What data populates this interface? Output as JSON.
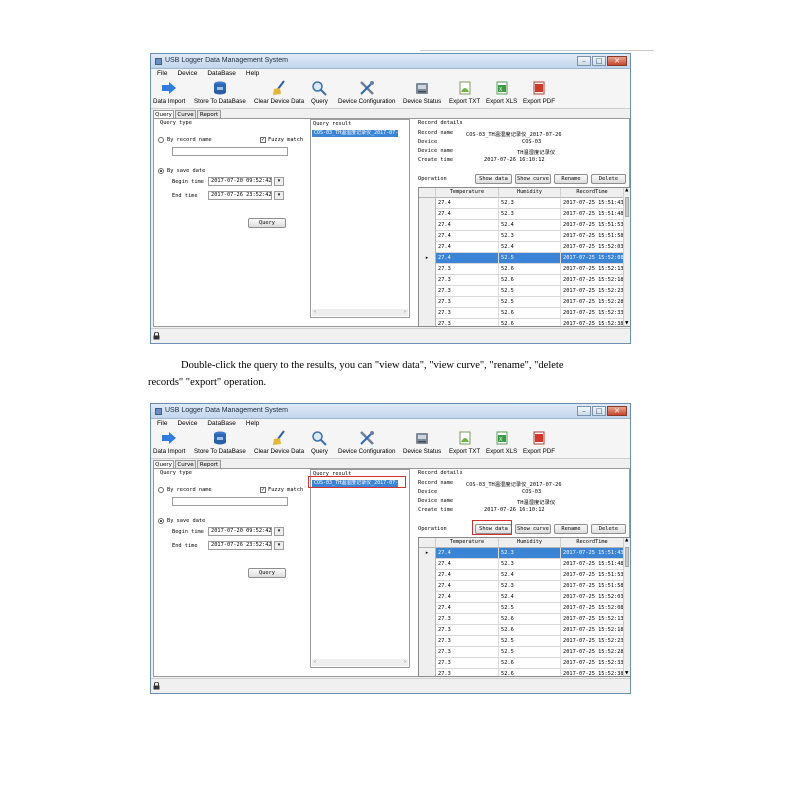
{
  "paragraph": {
    "line1": "Double-click the query to the results, you can \"view data\", \"view curve\", \"rename\", \"delete",
    "line2": "records\" \"export\" operation."
  },
  "app": {
    "title": "USB Logger Data Management System",
    "menus": [
      "File",
      "Device",
      "DataBase",
      "Help"
    ],
    "toolbar": [
      {
        "label": "Data Import",
        "icon": "arrow-right-icon"
      },
      {
        "label": "Store To DataBase",
        "icon": "database-icon"
      },
      {
        "label": "Clear Device Data",
        "icon": "broom-icon"
      },
      {
        "label": "Query",
        "icon": "magnifier-icon"
      },
      {
        "label": "Device Configuration",
        "icon": "tools-icon"
      },
      {
        "label": "Device Status",
        "icon": "device-icon"
      },
      {
        "label": "Export TXT",
        "icon": "txt-file-icon"
      },
      {
        "label": "Export XLS",
        "icon": "xls-file-icon"
      },
      {
        "label": "Export PDF",
        "icon": "pdf-file-icon"
      }
    ],
    "tabs": [
      "Query",
      "Curve",
      "Report"
    ],
    "query": {
      "query_type": "Query type",
      "by_record_name": "By record name",
      "fuzzy_match": "Fuzzy match",
      "by_save_date": "By save date",
      "begin_time_label": "Begin time",
      "begin_time_value": "2017-07-20 09:52:42",
      "end_time_label": "End time",
      "end_time_value": "2017-07-26 23:52:42",
      "query_button": "Query"
    },
    "query_result": {
      "header": "Query result",
      "item": "COS-03_TH温湿度记录仪_2017-07-26"
    },
    "record_details": {
      "header": "Record details",
      "record_name_label": "Record name",
      "record_name_value": "COS-03_TH温湿度记录仪_2017-07-26",
      "device_label": "Device",
      "device_value": "COS-03",
      "device_name_label": "Device name",
      "device_name_value": "TH温湿度记录仪",
      "create_time_label": "Create time",
      "create_time_value": "2017-07-26 16:10:12",
      "operation_label": "Operation",
      "buttons": [
        "Show data",
        "Show curve",
        "Rename",
        "Delete"
      ]
    },
    "table": {
      "columns": [
        "Temperature",
        "Humidity",
        "RecordTime"
      ],
      "rows_window1": [
        [
          "27.4",
          "52.3",
          "2017-07-25 15:51:43"
        ],
        [
          "27.4",
          "52.3",
          "2017-07-25 15:51:48"
        ],
        [
          "27.4",
          "52.4",
          "2017-07-25 15:51:53"
        ],
        [
          "27.4",
          "52.3",
          "2017-07-25 15:51:58"
        ],
        [
          "27.4",
          "52.4",
          "2017-07-25 15:52:03"
        ],
        [
          "27.4",
          "52.5",
          "2017-07-25 15:52:08"
        ],
        [
          "27.3",
          "52.6",
          "2017-07-25 15:52:13"
        ],
        [
          "27.3",
          "52.6",
          "2017-07-25 15:52:18"
        ],
        [
          "27.3",
          "52.5",
          "2017-07-25 15:52:23"
        ],
        [
          "27.3",
          "52.5",
          "2017-07-25 15:52:28"
        ],
        [
          "27.3",
          "52.6",
          "2017-07-25 15:52:33"
        ],
        [
          "27.3",
          "52.6",
          "2017-07-25 15:52:38"
        ]
      ],
      "selected_row_window1": 5,
      "rows_window2": [
        [
          "27.4",
          "52.3",
          "2017-07-25 15:51:43"
        ],
        [
          "27.4",
          "52.3",
          "2017-07-25 15:51:48"
        ],
        [
          "27.4",
          "52.4",
          "2017-07-25 15:51:53"
        ],
        [
          "27.4",
          "52.3",
          "2017-07-25 15:51:58"
        ],
        [
          "27.4",
          "52.4",
          "2017-07-25 15:52:03"
        ],
        [
          "27.4",
          "52.5",
          "2017-07-25 15:52:08"
        ],
        [
          "27.3",
          "52.6",
          "2017-07-25 15:52:13"
        ],
        [
          "27.3",
          "52.6",
          "2017-07-25 15:52:18"
        ],
        [
          "27.3",
          "52.5",
          "2017-07-25 15:52:23"
        ],
        [
          "27.3",
          "52.5",
          "2017-07-25 15:52:28"
        ],
        [
          "27.3",
          "52.6",
          "2017-07-25 15:52:33"
        ],
        [
          "27.3",
          "52.6",
          "2017-07-25 15:52:38"
        ]
      ],
      "selected_row_window2": 0
    },
    "colors": {
      "selection": "#3b84d6",
      "highlight_box": "#d2322d",
      "title_bar": "#c2d6ec"
    }
  }
}
